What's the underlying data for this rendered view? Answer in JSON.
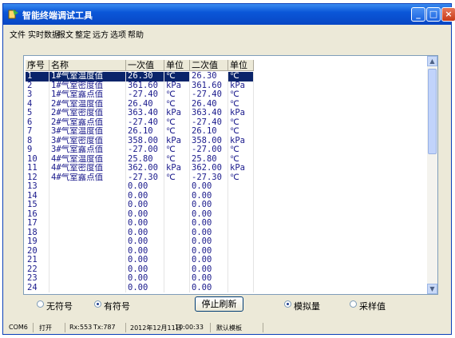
{
  "window": {
    "title": "智能终端调试工具"
  },
  "menu": [
    "文件",
    "实时数据",
    "报文",
    "整定",
    "远方",
    "选项",
    "帮助"
  ],
  "grid": {
    "headers": [
      "序号",
      "名称",
      "一次值",
      "单位",
      "二次值",
      "单位"
    ],
    "rows": [
      {
        "no": "1",
        "name": "1#气室温度值",
        "v1": "26.30",
        "u1": "℃",
        "v2": "26.30",
        "u2": "℃"
      },
      {
        "no": "2",
        "name": "1#气室密度值",
        "v1": "361.60",
        "u1": "kPa",
        "v2": "361.60",
        "u2": "kPa"
      },
      {
        "no": "3",
        "name": "1#气室露点值",
        "v1": "-27.40",
        "u1": "℃",
        "v2": "-27.40",
        "u2": "℃"
      },
      {
        "no": "4",
        "name": "2#气室温度值",
        "v1": "26.40",
        "u1": "℃",
        "v2": "26.40",
        "u2": "℃"
      },
      {
        "no": "5",
        "name": "2#气室密度值",
        "v1": "363.40",
        "u1": "kPa",
        "v2": "363.40",
        "u2": "kPa"
      },
      {
        "no": "6",
        "name": "2#气室露点值",
        "v1": "-27.40",
        "u1": "℃",
        "v2": "-27.40",
        "u2": "℃"
      },
      {
        "no": "7",
        "name": "3#气室温度值",
        "v1": "26.10",
        "u1": "℃",
        "v2": "26.10",
        "u2": "℃"
      },
      {
        "no": "8",
        "name": "3#气室密度值",
        "v1": "358.00",
        "u1": "kPa",
        "v2": "358.00",
        "u2": "kPa"
      },
      {
        "no": "9",
        "name": "3#气室露点值",
        "v1": "-27.00",
        "u1": "℃",
        "v2": "-27.00",
        "u2": "℃"
      },
      {
        "no": "10",
        "name": "4#气室温度值",
        "v1": "25.80",
        "u1": "℃",
        "v2": "25.80",
        "u2": "℃"
      },
      {
        "no": "11",
        "name": "4#气室密度值",
        "v1": "362.00",
        "u1": "kPa",
        "v2": "362.00",
        "u2": "kPa"
      },
      {
        "no": "12",
        "name": "4#气室露点值",
        "v1": "-27.30",
        "u1": "℃",
        "v2": "-27.30",
        "u2": "℃"
      },
      {
        "no": "13",
        "name": "",
        "v1": "0.00",
        "u1": "",
        "v2": "0.00",
        "u2": ""
      },
      {
        "no": "14",
        "name": "",
        "v1": "0.00",
        "u1": "",
        "v2": "0.00",
        "u2": ""
      },
      {
        "no": "15",
        "name": "",
        "v1": "0.00",
        "u1": "",
        "v2": "0.00",
        "u2": ""
      },
      {
        "no": "16",
        "name": "",
        "v1": "0.00",
        "u1": "",
        "v2": "0.00",
        "u2": ""
      },
      {
        "no": "17",
        "name": "",
        "v1": "0.00",
        "u1": "",
        "v2": "0.00",
        "u2": ""
      },
      {
        "no": "18",
        "name": "",
        "v1": "0.00",
        "u1": "",
        "v2": "0.00",
        "u2": ""
      },
      {
        "no": "19",
        "name": "",
        "v1": "0.00",
        "u1": "",
        "v2": "0.00",
        "u2": ""
      },
      {
        "no": "20",
        "name": "",
        "v1": "0.00",
        "u1": "",
        "v2": "0.00",
        "u2": ""
      },
      {
        "no": "21",
        "name": "",
        "v1": "0.00",
        "u1": "",
        "v2": "0.00",
        "u2": ""
      },
      {
        "no": "22",
        "name": "",
        "v1": "0.00",
        "u1": "",
        "v2": "0.00",
        "u2": ""
      },
      {
        "no": "23",
        "name": "",
        "v1": "0.00",
        "u1": "",
        "v2": "0.00",
        "u2": ""
      },
      {
        "no": "24",
        "name": "",
        "v1": "0.00",
        "u1": "",
        "v2": "0.00",
        "u2": ""
      }
    ]
  },
  "controls": {
    "radio_unsigned": "无符号",
    "radio_signed": "有符号",
    "stop_button": "停止刷新",
    "radio_analog": "模拟量",
    "radio_sample": "采样值"
  },
  "status": {
    "port": "COM6",
    "state": "打开",
    "rx": "Rx:553",
    "tx": "Tx:787",
    "date": "2012年12月11日",
    "time": "10:00:33",
    "template": "默认模板"
  },
  "colors": {
    "titlebar": "#0a56d8",
    "selection": "#0a246a",
    "text": "#1a1a8c"
  }
}
